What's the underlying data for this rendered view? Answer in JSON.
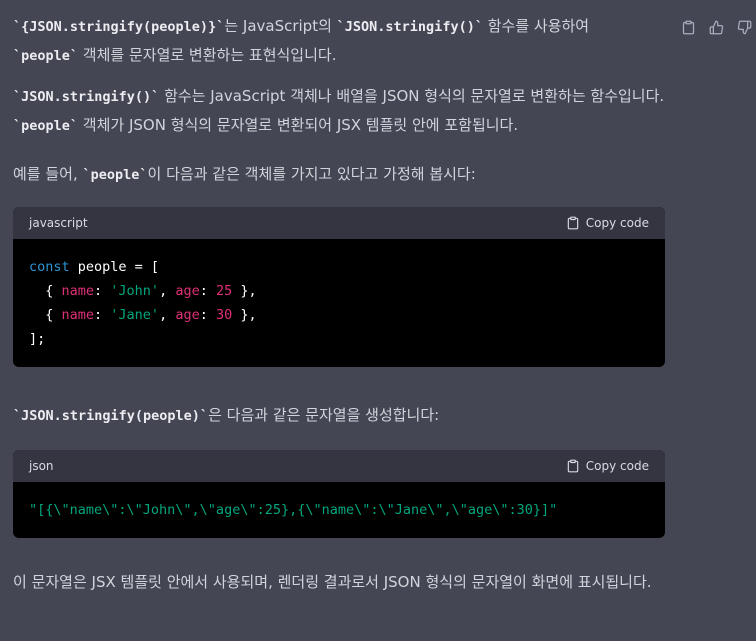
{
  "actions": {
    "copy_icon": "clipboard-icon",
    "thumbs_up_icon": "thumbs-up-icon",
    "thumbs_down_icon": "thumbs-down-icon"
  },
  "para1": {
    "code1": "`{JSON.stringify(people)}`",
    "text1": "는 JavaScript의 ",
    "code2": "`JSON.stringify()`",
    "text2": " 함수를 사용하여 ",
    "code3": "`people`",
    "text3": " 객체를 문자열로 변환하는 표현식입니다."
  },
  "para2": {
    "code1": "`JSON.stringify()`",
    "text1": " 함수는 JavaScript 객체나 배열을 JSON 형식의 문자열로 변환하는 함수입니다. ",
    "code2": "`people`",
    "text2": " 객체가 JSON 형식의 문자열로 변환되어 JSX 템플릿 안에 포함됩니다."
  },
  "para3": {
    "text1": "예를 들어, ",
    "code1": "`people`",
    "text2": "이 다음과 같은 객체를 가지고 있다고 가정해 봅시다:"
  },
  "code_js": {
    "language": "javascript",
    "copy_label": "Copy code",
    "line1": {
      "kw": "const",
      "rest": " people = ["
    },
    "line2": {
      "open": "  { ",
      "k1": "name",
      "s1": ": ",
      "v1": "'John'",
      "s2": ", ",
      "k2": "age",
      "s3": ": ",
      "v2": "25",
      "close": " },"
    },
    "line3": {
      "open": "  { ",
      "k1": "name",
      "s1": ": ",
      "v1": "'Jane'",
      "s2": ", ",
      "k2": "age",
      "s3": ": ",
      "v2": "30",
      "close": " },"
    },
    "line4": "];"
  },
  "para4": {
    "code1": "`JSON.stringify(people)`",
    "text1": "은 다음과 같은 문자열을 생성합니다:"
  },
  "code_json": {
    "language": "json",
    "copy_label": "Copy code",
    "line1": "\"[{\\\"name\\\":\\\"John\\\",\\\"age\\\":25},{\\\"name\\\":\\\"Jane\\\",\\\"age\\\":30}]\""
  },
  "para5": {
    "text1": "이 문자열은 JSX 템플릿 안에서 사용되며, 렌더링 결과로서 JSON 형식의 문자열이 화면에 표시됩니다."
  },
  "colors": {
    "background": "#444654",
    "code_bg": "#000000",
    "code_header_bg": "#343541",
    "keyword": "#2e95d3",
    "property": "#df3079",
    "string": "#00a67d"
  }
}
